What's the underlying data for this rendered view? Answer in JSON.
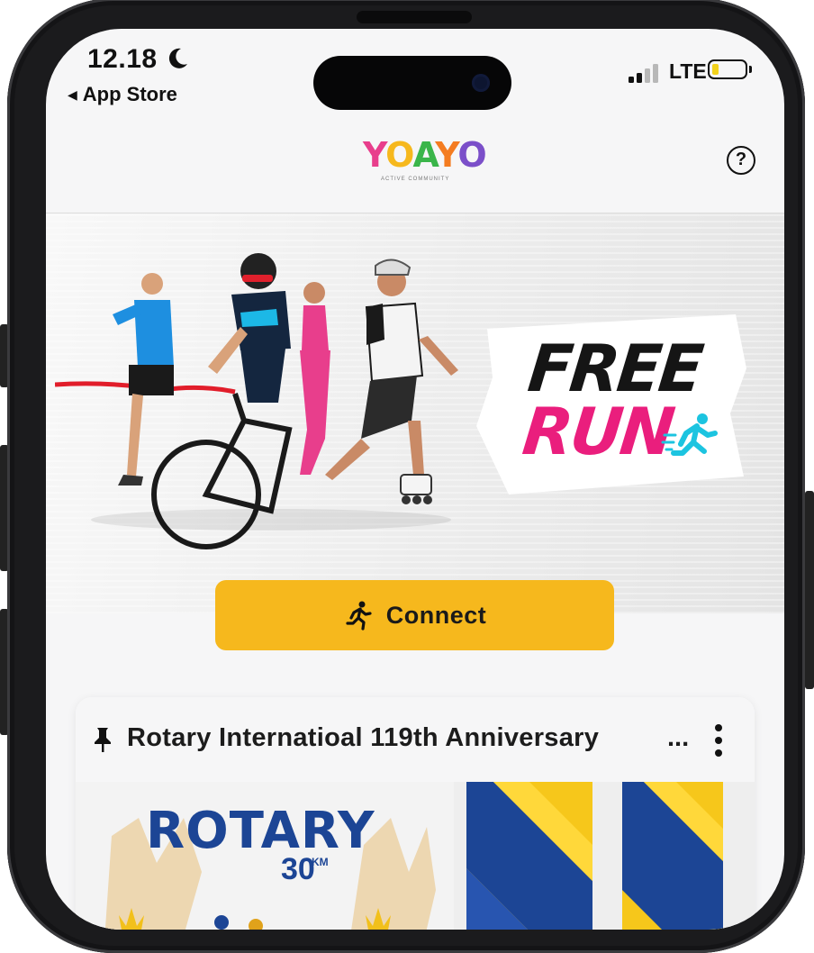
{
  "status_bar": {
    "time": "12.18",
    "back_label": "App Store",
    "network": "LTE"
  },
  "header": {
    "logo_text": [
      "Y",
      "O",
      "A",
      "Y",
      "O"
    ],
    "logo_colors": [
      "#e83e8c",
      "#f6b81d",
      "#3ab54a",
      "#f47c20",
      "#7b4fc9"
    ],
    "logo_subtitle": "ACTIVE COMMUNITY",
    "help_label": "?"
  },
  "hero": {
    "headline_1": "FREE",
    "headline_2": "RUN"
  },
  "connect": {
    "label": "Connect"
  },
  "event_card": {
    "title": "Rotary Internatioal 119th Anniversary",
    "ellipsis": "...",
    "banner_title": "ROTARY",
    "banner_distance": "30",
    "banner_unit": "KM"
  },
  "colors": {
    "accent": "#f6b81d",
    "brand_pink": "#ea1e7d",
    "brand_cyan": "#1cc4e0",
    "rotary_blue": "#1c4595"
  }
}
